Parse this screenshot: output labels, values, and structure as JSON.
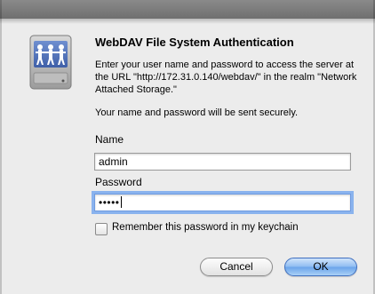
{
  "dialog": {
    "title": "WebDAV File System Authentication",
    "message": "Enter your user name and password to access the server at the URL \"http://172.31.0.140/webdav/\" in the realm \"Network Attached Storage.\"",
    "secure_note": "Your name and password will be sent securely.",
    "icon": "network-drive-icon"
  },
  "form": {
    "name_label": "Name",
    "name_value": "admin",
    "password_label": "Password",
    "password_masked": "•••••",
    "remember_label": "Remember this password in my keychain",
    "remember_checked": false
  },
  "buttons": {
    "cancel": "Cancel",
    "ok": "OK"
  },
  "colors": {
    "background": "#ececec",
    "focus_ring": "#8ab3ee",
    "default_button": "#6aa3ea"
  }
}
